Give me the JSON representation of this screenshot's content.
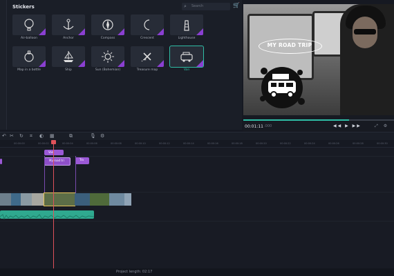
{
  "stickers": {
    "title": "Stickers",
    "search_placeholder": "Search",
    "items": [
      {
        "label": "Air-balloon",
        "icon": "air-balloon-icon"
      },
      {
        "label": "Anchor",
        "icon": "anchor-icon"
      },
      {
        "label": "Compass",
        "icon": "compass-icon"
      },
      {
        "label": "Crescent",
        "icon": "crescent-icon"
      },
      {
        "label": "Lighthouse",
        "icon": "lighthouse-icon"
      },
      {
        "label": "Map in a bottle",
        "icon": "map-bottle-icon"
      },
      {
        "label": "Ship",
        "icon": "ship-icon"
      },
      {
        "label": "Sun (Bohemian)",
        "icon": "sun-icon"
      },
      {
        "label": "Treasure map",
        "icon": "treasure-map-icon"
      },
      {
        "label": "Van",
        "icon": "van-icon",
        "selected": true
      }
    ]
  },
  "preview": {
    "title_overlay": "MY ROAD TRIP",
    "time_current": "00:01:11",
    "time_total": ":000",
    "progress_fraction": 0.7,
    "controls": "◀◀ ▶ ▶▶",
    "tools": "⤢ ⚙"
  },
  "toolbar": {
    "icons": [
      "cut-icon",
      "redo-icon",
      "crop-icon",
      "color-icon",
      "delete-icon",
      "copy-icon",
      "mic-icon",
      "settings-icon"
    ]
  },
  "ruler": {
    "ticks": [
      "00:00:00",
      "00:00:02",
      "00:00:04",
      "00:00:06",
      "00:00:08",
      "00:00:10",
      "00:00:12",
      "00:00:14",
      "00:00:16",
      "00:00:18",
      "00:00:20",
      "00:00:22",
      "00:00:24",
      "00:00:26",
      "00:00:28",
      "00:00:30"
    ]
  },
  "clips": {
    "sticker_clip": "Van",
    "text_clip_1": "My road tri",
    "text_clip_2": "Tra"
  },
  "footer": {
    "project_length": "Project length:  02:17"
  },
  "colors": {
    "accent": "#2fbfa6",
    "sticker_badge": "#8a3fd1",
    "clip_purple": "#9b59d6",
    "audio": "#2fa98f",
    "playhead": "#e0525a"
  }
}
